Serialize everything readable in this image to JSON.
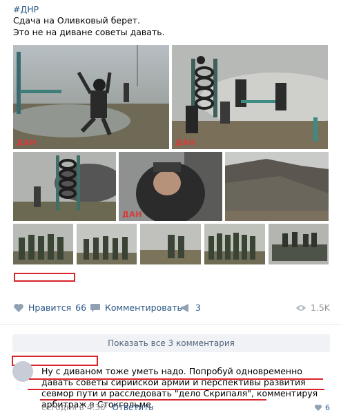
{
  "post": {
    "hashtag": "#ДНР",
    "line1": "Сдача на Оливковый берет.",
    "line2": "Это не на диване советы давать.",
    "watermark": "ДАН"
  },
  "photos": [
    {
      "name": "photo-1",
      "desc": "jumping soldier in smoke"
    },
    {
      "name": "photo-2",
      "desc": "tire obstacle course"
    },
    {
      "name": "photo-3",
      "desc": "tire tower"
    },
    {
      "name": "photo-4",
      "desc": "closeup of fighter"
    },
    {
      "name": "photo-5",
      "desc": "terrain hill"
    },
    {
      "name": "photo-6",
      "desc": "group of soldiers"
    },
    {
      "name": "photo-7",
      "desc": "soldiers formation"
    },
    {
      "name": "photo-8",
      "desc": "soldiers in field"
    },
    {
      "name": "photo-9",
      "desc": "soldiers with weapons"
    },
    {
      "name": "photo-10",
      "desc": "soldiers on vehicle"
    }
  ],
  "actions": {
    "like_label": "Нравится",
    "like_count": "66",
    "comment_label": "Комментировать",
    "share_count": "3",
    "views": "1.5K"
  },
  "comments": {
    "show_all": "Показать все 3 комментария",
    "items": [
      {
        "text": "Ну с диваном тоже уметь надо. Попробуй одновременно давать советы сирийской армии и перспективы развития севмор пути и расследовать \"дело Скрипаля\", комментируя арбитраж в Стокгольме.",
        "time": "сегодня в 4:30",
        "reply": "Ответить",
        "likes": "6"
      }
    ]
  },
  "colors": {
    "link": "#2a5885",
    "muted": "#939393",
    "highlight": "#d8232a"
  }
}
